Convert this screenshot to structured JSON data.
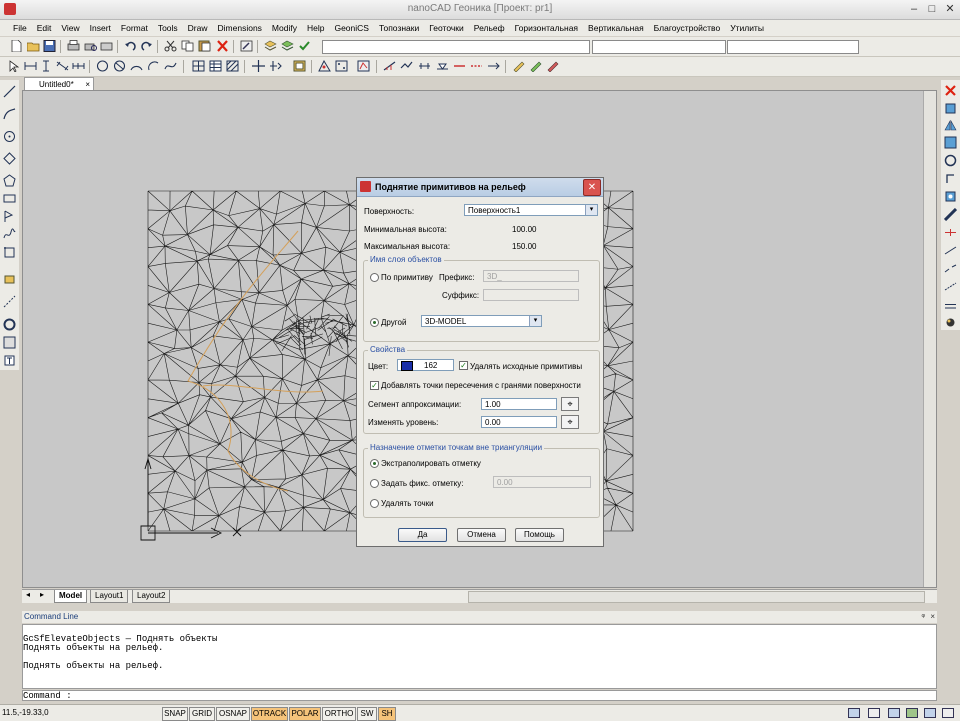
{
  "window": {
    "title": "nanoCAD Геоника [Проект: pr1]"
  },
  "menu": [
    "File",
    "Edit",
    "View",
    "Insert",
    "Format",
    "Tools",
    "Draw",
    "Dimensions",
    "Modify",
    "Help",
    "GeoniCS",
    "Топознаки",
    "Геоточки",
    "Рельеф",
    "Горизонтальная",
    "Вертикальная",
    "Благоустройство",
    "Утилиты"
  ],
  "document_tab": "Untitled0*",
  "layout_tabs": [
    "Model",
    "Layout1",
    "Layout2"
  ],
  "command": {
    "header": "Command Line",
    "lines": [
      "GcSfElevateObjects — Поднять объекты",
      "Поднять объекты на рельеф.",
      "",
      "Поднять объекты на рельеф."
    ],
    "prompt": "Command :"
  },
  "status": {
    "coords": "11.5,-19.33,0",
    "buttons": [
      "SNAP",
      "GRID",
      "OSNAP",
      "OTRACK",
      "POLAR",
      "ORTHO",
      "SW",
      "SH"
    ],
    "active": [
      "OTRACK",
      "POLAR",
      "SH"
    ]
  },
  "dialog": {
    "title": "Поднятие примитивов на рельеф",
    "surface_label": "Поверхность:",
    "surface_value": "Поверхность1",
    "min_height_label": "Минимальная высота:",
    "min_height_value": "100.00",
    "max_height_label": "Максимальная высота:",
    "max_height_value": "150.00",
    "layer_group": "Имя слоя объектов",
    "by_primitive": "По примитиву",
    "prefix_label": "Префикс:",
    "prefix_value": "3D_",
    "suffix_label": "Суффикс:",
    "other_label": "Другой",
    "other_value": "3D-MODEL",
    "props_group": "Свойства",
    "color_label": "Цвет:",
    "color_value": "162",
    "color_swatch": "#1a2fa8",
    "delete_source": "Удалять исходные примитивы",
    "add_points": "Добавлять точки пересечения с гранями поверхности",
    "approx_label": "Сегмент аппроксимации:",
    "approx_value": "1.00",
    "level_label": "Изменять уровень:",
    "level_value": "0.00",
    "outside_group": "Назначение отметки точкам вне триангуляции",
    "extrapolate": "Экстраполировать отметку",
    "fixed_label": "Задать фикс. отметку:",
    "fixed_value": "0.00",
    "delete_points": "Удалять точки",
    "ok": "Да",
    "cancel": "Отмена",
    "help": "Помощь"
  },
  "colors": {
    "mesh": "#1a1a1a",
    "contour": "#d4a05a",
    "viewport": "#c8c8c8"
  }
}
